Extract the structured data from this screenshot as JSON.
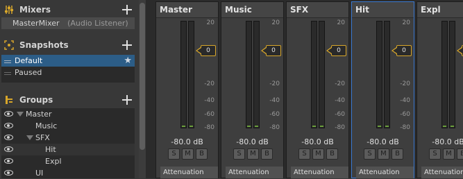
{
  "mixers": {
    "title": "Mixers",
    "item_name": "MasterMixer",
    "item_note": "(Audio Listener)"
  },
  "snapshots": {
    "title": "Snapshots",
    "items": [
      {
        "label": "Default",
        "selected": true,
        "starred": true
      },
      {
        "label": "Paused",
        "selected": false,
        "starred": false
      }
    ]
  },
  "groups": {
    "title": "Groups",
    "items": [
      {
        "label": "Master",
        "indent": 0,
        "expanded": true
      },
      {
        "label": "Music",
        "indent": 1
      },
      {
        "label": "SFX",
        "indent": 1,
        "expanded": true
      },
      {
        "label": "Hit",
        "indent": 2
      },
      {
        "label": "Expl",
        "indent": 2
      },
      {
        "label": "UI",
        "indent": 1
      }
    ]
  },
  "ticks": [
    "20",
    "0",
    "-20",
    "-40",
    "-60",
    "-80"
  ],
  "strips": [
    {
      "name": "Master",
      "fader": "0",
      "db": "-80.0 dB",
      "s": "S",
      "m": "M",
      "b": "B",
      "atten": "Attenuation",
      "active": false
    },
    {
      "name": "Music",
      "fader": "0",
      "db": "-80.0 dB",
      "s": "S",
      "m": "M",
      "b": "B",
      "atten": "Attenuation",
      "active": false
    },
    {
      "name": "SFX",
      "fader": "0",
      "db": "-80.0 dB",
      "s": "S",
      "m": "M",
      "b": "B",
      "atten": "Attenuation",
      "active": false
    },
    {
      "name": "Hit",
      "fader": "0",
      "db": "-80.0 dB",
      "s": "S",
      "m": "M",
      "b": "B",
      "atten": "Attenuation",
      "active": true
    },
    {
      "name": "Expl",
      "fader": "0",
      "db": "-80.0 dB",
      "s": "S",
      "m": "M",
      "b": "B",
      "atten": "Attenuation",
      "active": false
    }
  ],
  "colors": {
    "accent": "#d7a62a",
    "selection": "#2c5d87",
    "active_border": "#3a79d2",
    "meter_level": "#6a9f3a"
  }
}
